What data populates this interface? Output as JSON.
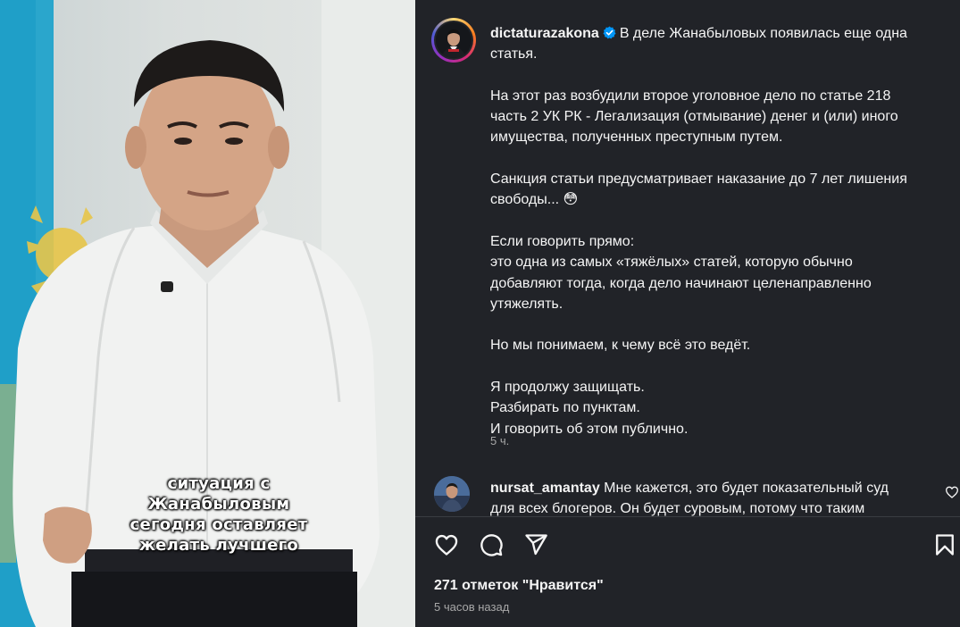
{
  "post": {
    "username": "dictaturazakona",
    "verified": true,
    "caption_paragraphs": [
      [
        "В деле Жанабыловых появилась еще одна",
        "статья."
      ],
      [
        "На этот раз возбудили второе уголовное дело по статье 218",
        "часть 2 УК РК - Легализация (отмывание) денег и (или) иного",
        "имущества, полученных преступным путем."
      ],
      [
        "Санкция статьи предусматривает наказание до 7 лет лишения",
        "свободы... 😳"
      ],
      [
        "Если говорить прямо:",
        "это одна из самых «тяжёлых» статей, которую обычно",
        "добавляют тогда, когда дело начинают целенаправленно",
        "утяжелять."
      ],
      [
        "Но мы понимаем, к чему всё это ведёт."
      ],
      [
        "Я продолжу защищать.",
        "Разбирать по пунктам.",
        "И говорить об этом публично."
      ]
    ],
    "time_short": "5 ч.",
    "likes": "271 отметок \"Нравится\"",
    "time_long": "5 часов назад"
  },
  "comment": {
    "username": "nursat_amantay",
    "text_line1": "Мне кажется, это будет показательный суд",
    "text_line2": "для всех блогеров. Он будет суровым, потому что таким"
  },
  "video": {
    "overlay_lines": [
      "ситуация с",
      "Жанабыловым",
      "сегодня оставляет",
      "желать лучшего"
    ]
  },
  "icons": {
    "like": "heart-icon",
    "comment": "comment-icon",
    "share": "paper-plane-icon",
    "save": "bookmark-icon",
    "verified": "verified-badge-icon"
  },
  "colors": {
    "panel_bg": "#212328",
    "text": "#f5f5f5",
    "muted": "#a8a8a8",
    "verified_blue": "#0095f6"
  }
}
